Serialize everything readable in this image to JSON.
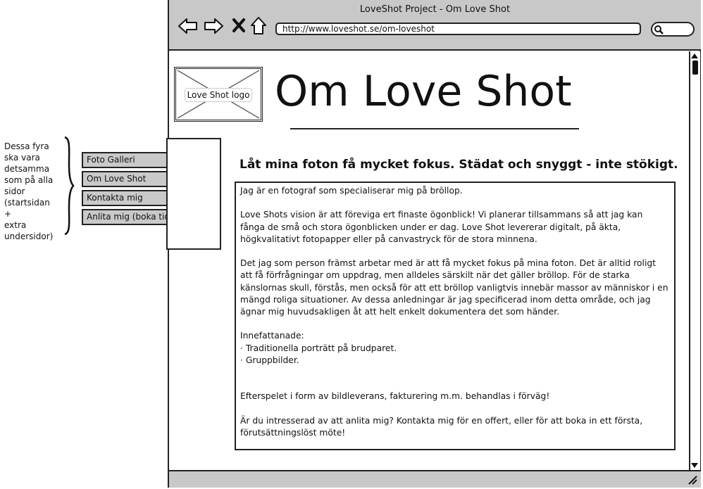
{
  "annotation": {
    "lines": [
      "Dessa fyra",
      "ska vara",
      "detsamma",
      "som på alla",
      "sidor",
      "(startsidan +",
      "extra",
      "undersidor)"
    ]
  },
  "tabs": [
    {
      "label": "Foto Galleri"
    },
    {
      "label": "Om Love Shot"
    },
    {
      "label": "Kontakta mig"
    },
    {
      "label": "Anlita mig (boka tid)"
    }
  ],
  "browser": {
    "title": "LoveShot Project - Om Love Shot",
    "url": "http://www.loveshot.se/om-loveshot"
  },
  "page": {
    "logo_label": "Love Shot logo",
    "heading": "Om Love Shot",
    "tagline": "Låt mina foton få mycket fokus. Städat och snyggt - inte stökigt.",
    "paragraphs": {
      "p1": "Jag är en fotograf som specialiserar mig på bröllop.",
      "p2": "Love Shots vision är att föreviga ert finaste ögonblick! Vi planerar tillsammans så att jag kan fånga de små och stora ögonblicken under er dag. Love Shot levererar digitalt, på äkta, högkvalitativt fotopapper eller på canvastryck för de stora minnena.",
      "p3": "Det jag som person främst arbetar med är att få mycket fokus på mina foton. Det är alltid roligt att få förfrågningar om uppdrag, men alldeles särskilt när det gäller bröllop. För de starka känslornas skull, förstås, men också för att ett bröllop vanligtvis innebär massor av människor i en mängd roliga situationer. Av dessa anledningar är jag specificerad inom detta område, och jag ägnar mig huvudsakligen åt att helt enkelt dokumentera det som händer.",
      "list_title": "Innefattanade:",
      "item1": "· Traditionella porträtt på brudparet.",
      "item2": "· Gruppbilder.",
      "p4": "Efterspelet i form av bildleverans, fakturering m.m. behandlas i förväg!",
      "p5": "Är du intresserad av att anlita mig? Kontakta mig för en offert, eller för att boka in ett första, förutsättningslöst möte!"
    }
  }
}
